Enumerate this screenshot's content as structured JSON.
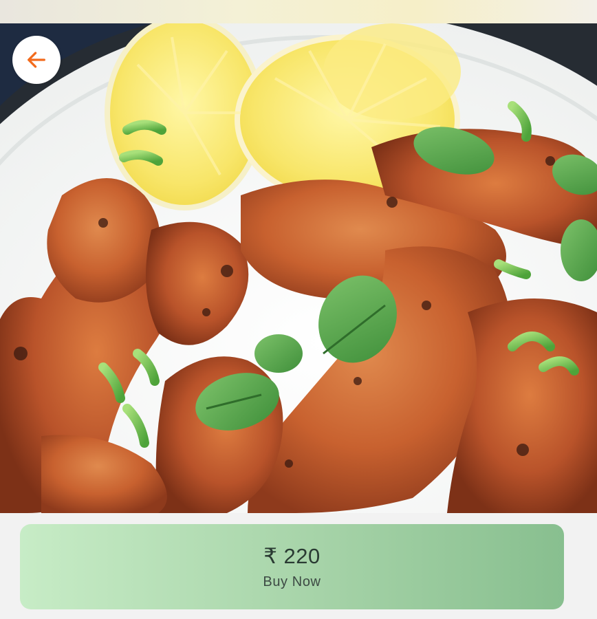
{
  "header": {
    "back_icon": "arrow-left-icon",
    "accent_color": "#f26b1d"
  },
  "product_image": {
    "subject": "food-image"
  },
  "purchase": {
    "price": "₹ 220",
    "cta_label": "Buy Now",
    "button_color": "#a6d3a8"
  }
}
